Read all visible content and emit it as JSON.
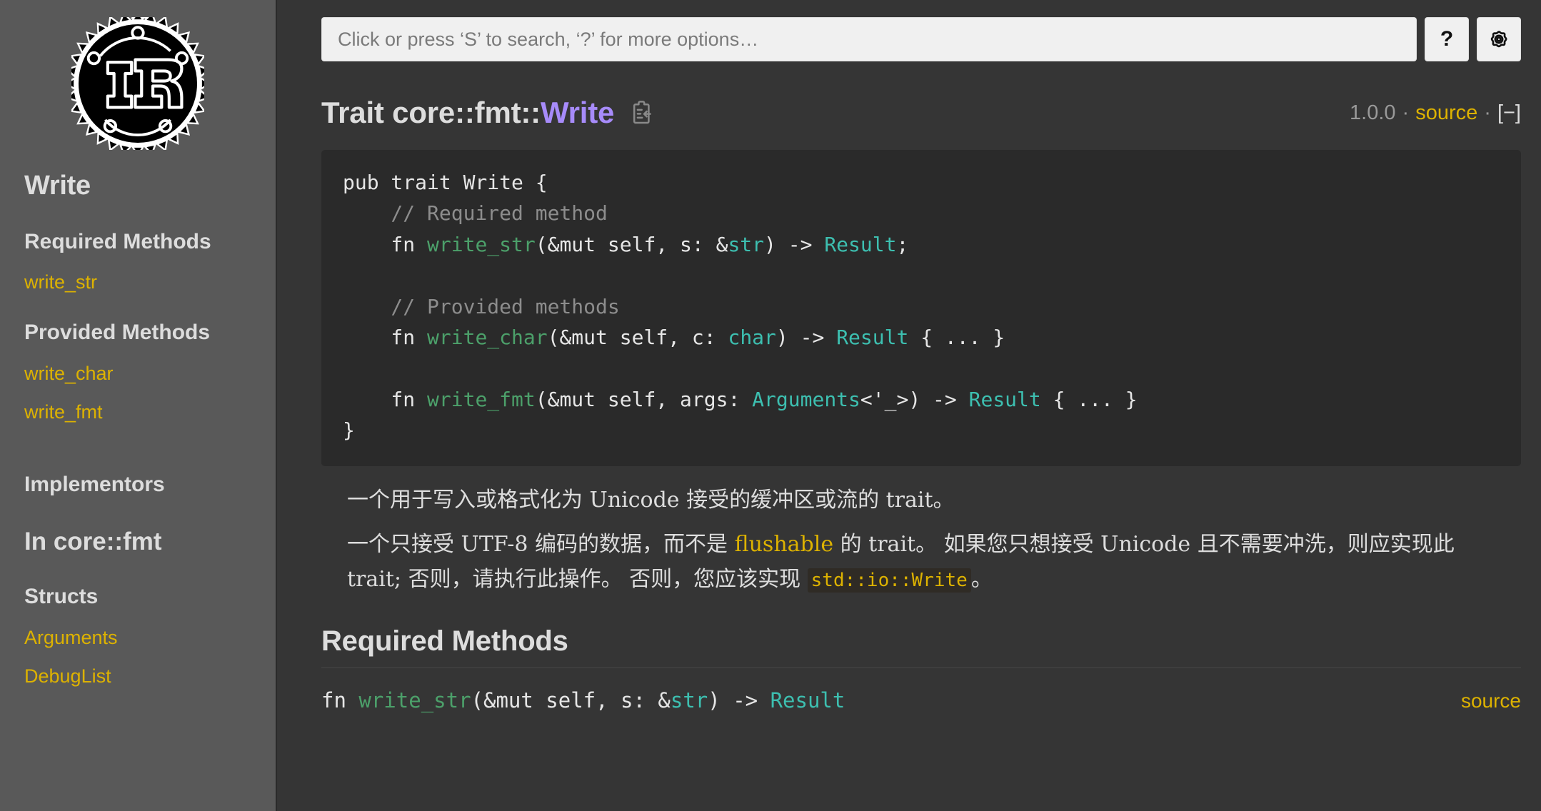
{
  "theme": {
    "sidebar_bg": "#595959",
    "content_bg": "#353535",
    "code_bg": "#2a2a2a",
    "link_yellow": "#ddb200",
    "accent_purple": "#a78bfa",
    "type_teal": "#3dbfb0",
    "fn_green": "#4ca06a",
    "text": "#dddddd"
  },
  "sidebar": {
    "logo_name": "rust-logo",
    "title": "Write",
    "sections": [
      {
        "heading": "Required Methods",
        "links": [
          "write_str"
        ]
      },
      {
        "heading": "Provided Methods",
        "links": [
          "write_char",
          "write_fmt"
        ]
      },
      {
        "heading": "Implementors",
        "links": []
      }
    ],
    "crate_heading": "In core::fmt",
    "crate_sections": [
      {
        "heading": "Structs",
        "links": [
          "Arguments",
          "DebugList"
        ]
      }
    ]
  },
  "search": {
    "placeholder": "Click or press ‘S’ to search, ‘?’ for more options…",
    "value": "",
    "help_button_label": "?",
    "help_button_name": "question-mark-icon",
    "settings_button_name": "gear-icon"
  },
  "header": {
    "title_prefix": "Trait core::fmt::",
    "title_accent": "Write",
    "copy_icon_name": "copy-path-icon",
    "version": "1.0.0",
    "separator": "·",
    "source_label": "source",
    "collapse_toggle": "[−]"
  },
  "declaration": {
    "lines": [
      [
        {
          "t": "pub trait Write {",
          "c": "plain"
        }
      ],
      [
        {
          "t": "    // Required method",
          "c": "cmt"
        }
      ],
      [
        {
          "t": "    fn ",
          "c": "plain"
        },
        {
          "t": "write_str",
          "c": "fnm"
        },
        {
          "t": "(&mut self, s: &",
          "c": "plain"
        },
        {
          "t": "str",
          "c": "typ"
        },
        {
          "t": ") -> ",
          "c": "plain"
        },
        {
          "t": "Result",
          "c": "typ"
        },
        {
          "t": ";",
          "c": "plain"
        }
      ],
      [
        {
          "t": "",
          "c": "plain"
        }
      ],
      [
        {
          "t": "    // Provided methods",
          "c": "cmt"
        }
      ],
      [
        {
          "t": "    fn ",
          "c": "plain"
        },
        {
          "t": "write_char",
          "c": "fnm"
        },
        {
          "t": "(&mut self, c: ",
          "c": "plain"
        },
        {
          "t": "char",
          "c": "typ"
        },
        {
          "t": ") -> ",
          "c": "plain"
        },
        {
          "t": "Result",
          "c": "typ"
        },
        {
          "t": " { ... }",
          "c": "plain"
        }
      ],
      [
        {
          "t": "",
          "c": "plain"
        }
      ],
      [
        {
          "t": "    fn ",
          "c": "plain"
        },
        {
          "t": "write_fmt",
          "c": "fnm"
        },
        {
          "t": "(&mut self, args: ",
          "c": "plain"
        },
        {
          "t": "Arguments",
          "c": "typ"
        },
        {
          "t": "<'_>) -> ",
          "c": "plain"
        },
        {
          "t": "Result",
          "c": "typ"
        },
        {
          "t": " { ... }",
          "c": "plain"
        }
      ],
      [
        {
          "t": "}",
          "c": "plain"
        }
      ]
    ]
  },
  "description": {
    "paragraph1": "一个用于写入或格式化为 Unicode 接受的缓冲区或流的 trait。",
    "p2_a": "一个只接受 UTF-8 编码的数据，而不是 ",
    "p2_link": "flushable",
    "p2_b": " 的 trait。 如果您只想接受 Unicode 且不需要冲洗，则应实现此 trait; 否则，请执行此操作。 否则，您应该实现 ",
    "p2_code": "std::io::Write",
    "p2_c": "。"
  },
  "required_methods_section": {
    "heading": "Required Methods",
    "methods": [
      {
        "parts": [
          {
            "t": "fn ",
            "c": "plain"
          },
          {
            "t": "write_str",
            "c": "fnm"
          },
          {
            "t": "(&mut self, s: &",
            "c": "plain"
          },
          {
            "t": "str",
            "c": "typ"
          },
          {
            "t": ") -> ",
            "c": "plain"
          },
          {
            "t": "Result",
            "c": "typ"
          }
        ],
        "source_label": "source"
      }
    ]
  }
}
